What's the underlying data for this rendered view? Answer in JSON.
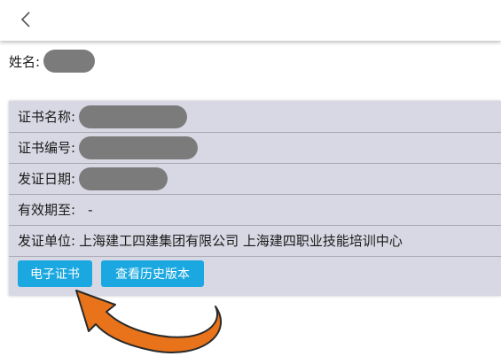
{
  "header": {
    "back_icon": "chevron-left-icon"
  },
  "person": {
    "name_label": "姓名:"
  },
  "certificate": {
    "rows": [
      {
        "label": "证书名称:"
      },
      {
        "label": "证书编号:"
      },
      {
        "label": "发证日期:"
      },
      {
        "label": "有效期至:",
        "value": "-"
      },
      {
        "label": "发证单位:",
        "value": "上海建工四建集团有限公司 上海建四职业技能培训中心"
      }
    ],
    "buttons": {
      "electronic_cert": "电子证书",
      "history": "查看历史版本"
    }
  },
  "annotation": {
    "arrow_color": "#e8731a",
    "arrow_icon": "curved-arrow-icon"
  },
  "colors": {
    "button_bg": "#1ba8e0",
    "card_bg": "#d8d8e4",
    "redaction": "#7b7b7b"
  }
}
